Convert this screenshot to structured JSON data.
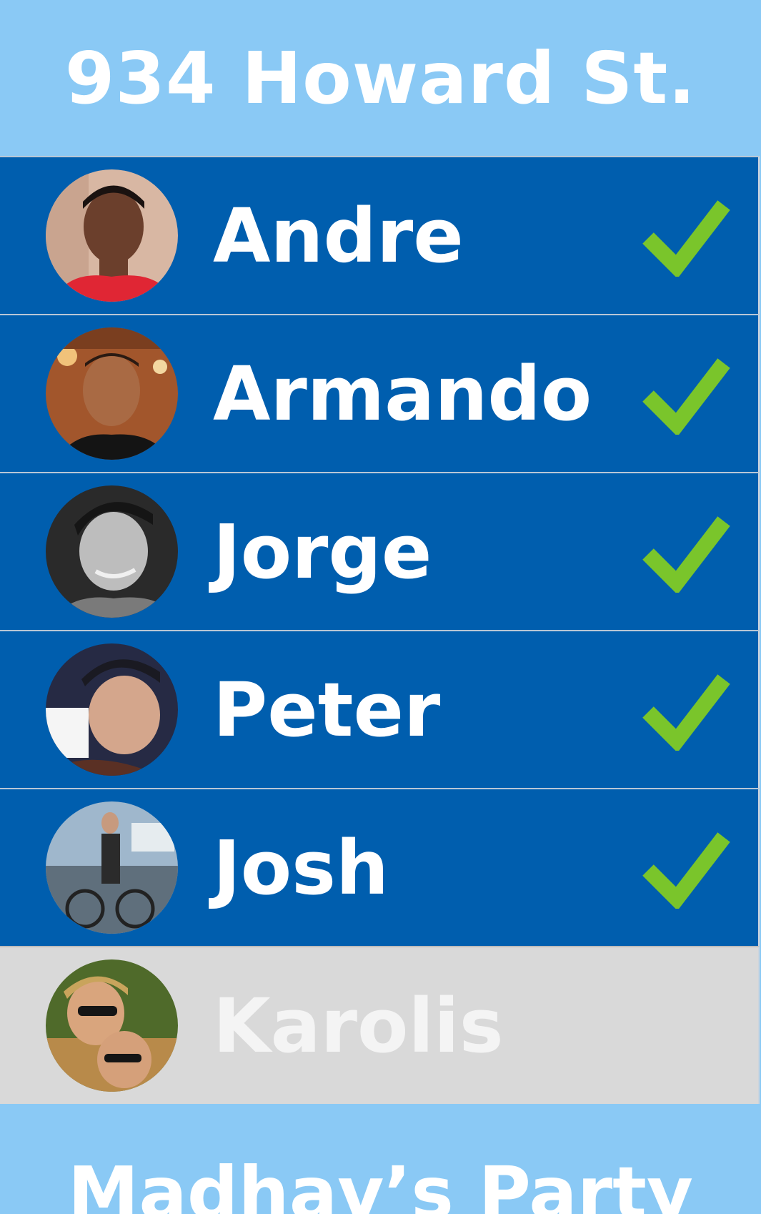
{
  "header": {
    "title": "934 Howard St."
  },
  "rows": [
    {
      "name": "Andre",
      "status": "accepted"
    },
    {
      "name": "Armando",
      "status": "accepted"
    },
    {
      "name": "Jorge",
      "status": "accepted"
    },
    {
      "name": "Peter",
      "status": "accepted"
    },
    {
      "name": "Josh",
      "status": "accepted"
    },
    {
      "name": "Karolis",
      "status": "pending"
    }
  ],
  "footer": {
    "title": "Madhav’s Party"
  },
  "colors": {
    "header_bg": "#8ac9f5",
    "row_accepted_bg": "#005eae",
    "row_pending_bg": "#d9d9d9",
    "check": "#7ac52b"
  },
  "icons": {
    "check": "checkmark-icon"
  }
}
